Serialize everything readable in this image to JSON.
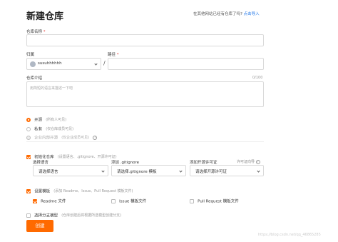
{
  "page": {
    "title": "新建仓库",
    "import_hint": "在其他网站已经有仓库了吗?",
    "import_link": "点击导入"
  },
  "repo_name": {
    "label": "仓库名称",
    "required_mark": "*",
    "value": ""
  },
  "owner": {
    "label": "归属",
    "value": "susuhhhhhh"
  },
  "path": {
    "separator": "/",
    "label": "路径",
    "required_mark": "*",
    "value": ""
  },
  "description": {
    "label": "仓库介绍",
    "counter": "0/100",
    "placeholder": "用简短的语言来描述一下吧"
  },
  "visibility": {
    "options": [
      {
        "label": "开源",
        "note": "(所有人可见)",
        "selected": true,
        "disabled": false
      },
      {
        "label": "私有",
        "note": "(仅仓库成员可见)",
        "selected": false,
        "disabled": false
      },
      {
        "label": "企业内部开源",
        "note": "(仅企业成员可见)",
        "selected": false,
        "disabled": true
      }
    ]
  },
  "init_repo": {
    "checked": true,
    "label": "初始化仓库",
    "note": "(设置语言、.gitignore、开源许可证)",
    "language": {
      "label": "选择语言",
      "value": "请选择语言"
    },
    "gitignore": {
      "label": "添加 .gitignore",
      "value": "请选择.gitignore 模板"
    },
    "license": {
      "label": "添加开源许可证",
      "help": "许可证向导",
      "value": "请选择开源许可证"
    }
  },
  "template": {
    "checked": true,
    "label": "设置模板",
    "note": "(添加 Readme、Issue、Pull Request 模板文件)",
    "items": [
      {
        "label": "Readme 文件",
        "checked": true
      },
      {
        "label": "Issue 模板文件",
        "checked": false
      },
      {
        "label": "Pull Request 模板文件",
        "checked": false
      }
    ]
  },
  "branch_model": {
    "checked": false,
    "label": "选择分支模型",
    "note": "(仓库创建后将根据所选模型创建分支)"
  },
  "create_button": "创建",
  "watermark": "https://blog.csdn.net/qq_46865285",
  "colors": {
    "accent": "#ff6a00",
    "link": "#1a73e8"
  }
}
